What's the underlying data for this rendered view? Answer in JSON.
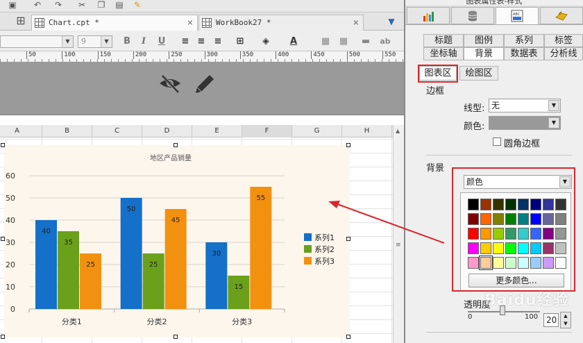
{
  "tabs": [
    {
      "label": "Chart.cpt *"
    },
    {
      "label": "WorkBook27 *"
    }
  ],
  "format_bar": {
    "font_size": "9",
    "bold": "B",
    "italic": "I",
    "underline": "U",
    "text_color_label": "A",
    "ab_label": "ab"
  },
  "ruler": {
    "marks": [
      "50",
      "100",
      "150",
      "200",
      "250",
      "300",
      "350",
      "400",
      "450",
      "500",
      "550"
    ]
  },
  "columns": [
    "A",
    "B",
    "C",
    "D",
    "E",
    "F",
    "G",
    "H"
  ],
  "chart_data": {
    "type": "bar",
    "title": "地区产品销量",
    "categories": [
      "分类1",
      "分类2",
      "分类3"
    ],
    "series": [
      {
        "name": "系列1",
        "values": [
          40,
          50,
          30
        ],
        "color": "#1470c8"
      },
      {
        "name": "系列2",
        "values": [
          35,
          25,
          15
        ],
        "color": "#6aa01a"
      },
      {
        "name": "系列3",
        "values": [
          25,
          45,
          55
        ],
        "color": "#f2910f"
      }
    ],
    "ylim": [
      0,
      60
    ],
    "yticks": [
      0,
      10,
      20,
      30,
      40,
      50,
      60
    ],
    "grid": true,
    "legend": "right",
    "background": "#fdf6ec"
  },
  "panel": {
    "title": "图表属性表-样式",
    "top_tabs_icons": [
      "bar-chart-icon",
      "database-icon",
      "text-style-icon",
      "special-effects-icon"
    ],
    "subtabs_row1": [
      "标题",
      "图例",
      "系列",
      "标签"
    ],
    "subtabs_row2": [
      "坐标轴",
      "背景",
      "数据表",
      "分析线"
    ],
    "area_tabs": [
      "图表区",
      "绘图区"
    ],
    "border_section": "边框",
    "line_type_label": "线型:",
    "line_type_value": "无",
    "color_label": "颜色:",
    "round_border_label": "圆角边框",
    "background_section": "背景",
    "bg_mode_value": "颜色",
    "more_colors": "更多颜色...",
    "transparency_label": "透明度",
    "slider_min": "0",
    "slider_max": "100",
    "transparency_value": "20",
    "watermark": "Baidu经验"
  },
  "palette": [
    [
      "#000000",
      "#993300",
      "#333300",
      "#003300",
      "#003366",
      "#000080",
      "#333399",
      "#333333"
    ],
    [
      "#800000",
      "#ff6600",
      "#808000",
      "#008000",
      "#008080",
      "#0000ff",
      "#666699",
      "#808080"
    ],
    [
      "#ff0000",
      "#ff9900",
      "#99cc00",
      "#339966",
      "#33cccc",
      "#3366ff",
      "#800080",
      "#969696"
    ],
    [
      "#ff00ff",
      "#ffcc00",
      "#ffff00",
      "#00ff00",
      "#00ffff",
      "#00ccff",
      "#993366",
      "#c0c0c0"
    ],
    [
      "#ff99cc",
      "#ffcc99",
      "#ffff99",
      "#ccffcc",
      "#ccffff",
      "#99ccff",
      "#cc99ff",
      "#ffffff"
    ]
  ],
  "colors": {
    "accent_red": "#d9262c",
    "panel_bg": "#efefef"
  }
}
